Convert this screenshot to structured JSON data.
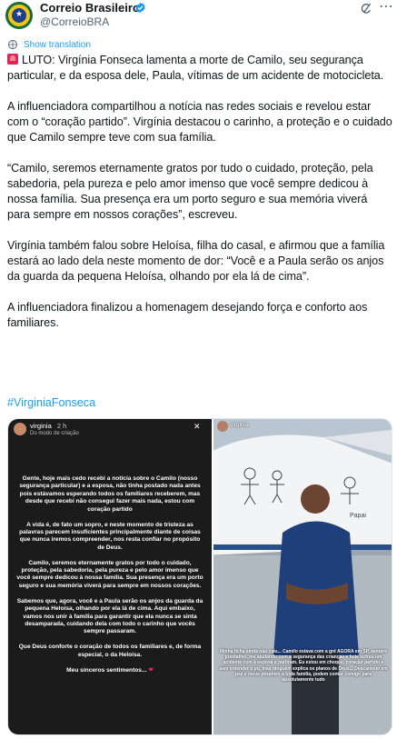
{
  "header": {
    "display_name": "Correio Brasileiro",
    "handle": "@CorreioBRA",
    "avatar_text": "CORREIO BRASILEIRO"
  },
  "translate_label": "Show translation",
  "post": {
    "paragraphs": [
      "LUTO: Virgínia Fonseca lamenta a morte de Camilo, seu segurança particular, e da esposa dele, Paula, vítimas de um acidente de motocicleta.",
      "A influenciadora compartilhou a notícia nas redes sociais e revelou estar com o “coração partido”. Virgínia destacou o carinho, a proteção e o cuidado que Camilo sempre teve com sua família.",
      "“Camilo, seremos eternamente gratos por tudo o cuidado, proteção, pela sabedoria, pela pureza e pelo amor imenso que você sempre dedicou à nossa família. Sua presença era um porto seguro e sua memória viverá para sempre em nossos corações”, escreveu.",
      "Virgínia também falou sobre Heloísa, filha do casal, e afirmou que a família estará ao lado dela neste momento de dor: “Você e a Paula serão os anjos da guarda da pequena Heloísa, olhando por ela lá de cima”.",
      "A influenciadora finalizou a homenagem desejando força e conforto aos familiares."
    ],
    "hashtag": "#VirginiaFonseca"
  },
  "media": {
    "left_story": {
      "user": "virginia",
      "time": "2 h",
      "subtitle": "Do modo de criação",
      "paragraphs": [
        "Gente, hoje mais cedo recebi a notícia sobre o Camilo (nosso segurança particular) e a esposa, não tinha postado nada antes pois estávamos esperando todos os familiares receberem, mas desde que recebi não consegui fazer mais nada, estou com coração partido",
        "A vida é, de fato um sopro, e neste momento de tristeza as palavras parecem insuficientes principalmente diante de coisas que nunca iremos compreender, nos resta confiar no propósito de Deus.",
        "Camilo, seremos eternamente gratos por todo o cuidado, proteção, pela sabedoria, pela pureza e pelo amor imenso que você sempre dedicou à nossa família. Sua presença era um porto seguro e sua memória viverá para sempre em nossos corações.",
        "Sabemos que, agora, você e a Paula serão os anjos da guarda da pequena Heloísa, olhando por ela lá de cima. Aqui embaixo, vamos nos unir à família para garantir que ela nunca se sinta desamparada, cuidando dela com todo o carinho que vocês sempre passaram.",
        "Que Deus conforte o coração de todos os familiares e, de forma especial, o da Heloísa.",
        "Meu sinceros sentimentos..."
      ]
    },
    "right_story": {
      "user": "virginia",
      "caption": "Minha ficha ainda não caiu... Camilo estava com a gnt AGORA em SP, sempre prestativo, me ajudando com a segurança das crianças e hoje sofreu um acidente com a esposa e partiram. Eu estou em choque, coração partido e sem entender o pq, mas ninguém explica os planos de Deus... Descansem em paz e meus pêsames a toda família, podem contar comigo para absolutamente tudo",
      "plane_text": "Papai"
    }
  },
  "colors": {
    "link": "#1d9bf0",
    "verified": "#1d9bf0",
    "secondary_text": "#536471"
  }
}
